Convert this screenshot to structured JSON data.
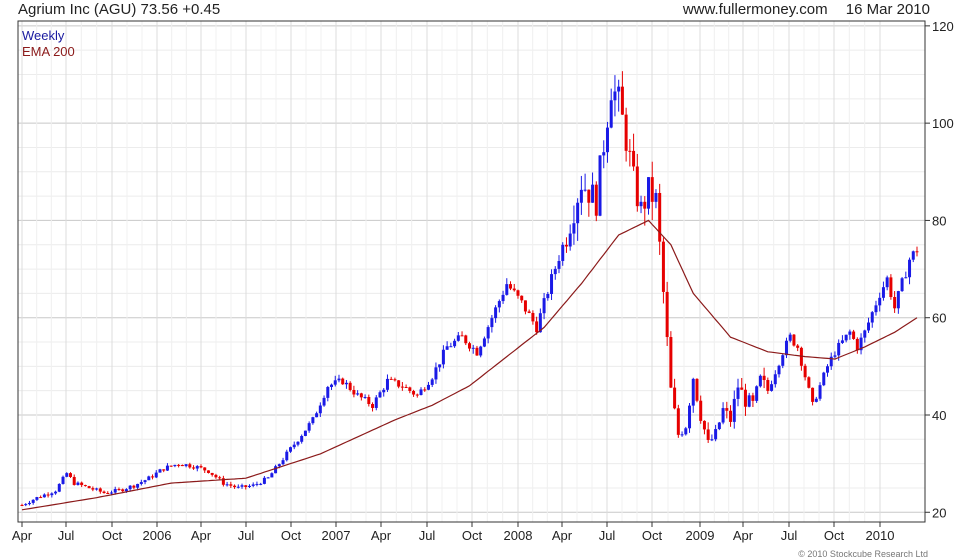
{
  "header": {
    "instrument": "Agrium Inc (AGU)",
    "last": "73.56",
    "change": "+0.45",
    "website": "www.fullermoney.com",
    "date": "16 Mar 2010"
  },
  "legend": {
    "weekly": "Weekly",
    "ema": "EMA 200"
  },
  "copyright": "© 2010 Stockcube Research Ltd",
  "colors": {
    "up": "#1a1ae6",
    "down": "#e60000",
    "ema": "#8b1a1a",
    "grid": "#d6d6d6"
  },
  "chart_data": {
    "type": "candlestick-ohlc",
    "title": "Agrium Inc (AGU)",
    "frequency": "Weekly",
    "ylim": [
      18,
      121
    ],
    "y_ticks": [
      20,
      40,
      60,
      80,
      100,
      120
    ],
    "x_ticks": [
      "Apr",
      "Jul",
      "Oct",
      "2006",
      "Apr",
      "Jul",
      "Oct",
      "2007",
      "Apr",
      "Jul",
      "Oct",
      "2008",
      "Apr",
      "Jul",
      "Oct",
      "2009",
      "Apr",
      "Jul",
      "Oct",
      "2010"
    ],
    "grid": true,
    "price_anchors": [
      [
        0,
        21.5
      ],
      [
        4,
        23
      ],
      [
        9,
        24.5
      ],
      [
        12,
        28
      ],
      [
        14,
        26
      ],
      [
        18,
        25
      ],
      [
        22,
        24
      ],
      [
        26,
        24.5
      ],
      [
        30,
        25.5
      ],
      [
        34,
        27
      ],
      [
        38,
        29
      ],
      [
        42,
        30
      ],
      [
        46,
        29.5
      ],
      [
        50,
        28.5
      ],
      [
        54,
        26
      ],
      [
        58,
        25
      ],
      [
        62,
        25.5
      ],
      [
        66,
        27
      ],
      [
        70,
        31
      ],
      [
        74,
        35
      ],
      [
        78,
        39
      ],
      [
        82,
        46
      ],
      [
        86,
        47
      ],
      [
        90,
        44
      ],
      [
        94,
        42
      ],
      [
        98,
        47
      ],
      [
        102,
        46
      ],
      [
        106,
        44
      ],
      [
        110,
        48
      ],
      [
        114,
        54
      ],
      [
        118,
        56
      ],
      [
        122,
        53
      ],
      [
        126,
        60
      ],
      [
        130,
        67
      ],
      [
        134,
        63
      ],
      [
        138,
        58
      ],
      [
        142,
        68
      ],
      [
        146,
        77
      ],
      [
        150,
        88
      ],
      [
        154,
        84
      ],
      [
        156,
        96
      ],
      [
        158,
        108
      ],
      [
        160,
        104
      ],
      [
        162,
        97
      ],
      [
        164,
        88
      ],
      [
        166,
        82
      ],
      [
        168,
        86
      ],
      [
        170,
        84
      ],
      [
        172,
        65
      ],
      [
        174,
        45
      ],
      [
        176,
        36
      ],
      [
        178,
        38
      ],
      [
        180,
        48
      ],
      [
        182,
        40
      ],
      [
        184,
        34
      ],
      [
        186,
        36
      ],
      [
        188,
        41
      ],
      [
        190,
        39
      ],
      [
        192,
        46
      ],
      [
        194,
        43
      ],
      [
        196,
        42
      ],
      [
        198,
        47
      ],
      [
        200,
        45
      ],
      [
        202,
        49
      ],
      [
        204,
        53
      ],
      [
        206,
        56
      ],
      [
        208,
        54
      ],
      [
        210,
        48
      ],
      [
        212,
        42
      ],
      [
        214,
        46
      ],
      [
        216,
        50
      ],
      [
        218,
        53
      ],
      [
        220,
        55
      ],
      [
        222,
        57
      ],
      [
        224,
        54
      ],
      [
        226,
        57
      ],
      [
        228,
        61
      ],
      [
        230,
        65
      ],
      [
        232,
        68
      ],
      [
        234,
        62
      ],
      [
        236,
        67
      ],
      [
        238,
        72
      ],
      [
        240,
        74
      ]
    ],
    "ema_200_anchors": [
      [
        0,
        20.5
      ],
      [
        20,
        23
      ],
      [
        40,
        26
      ],
      [
        60,
        27
      ],
      [
        80,
        32
      ],
      [
        100,
        39
      ],
      [
        110,
        42
      ],
      [
        120,
        46
      ],
      [
        130,
        52
      ],
      [
        140,
        58
      ],
      [
        150,
        67
      ],
      [
        160,
        77
      ],
      [
        168,
        80
      ],
      [
        174,
        75
      ],
      [
        180,
        65
      ],
      [
        190,
        56
      ],
      [
        200,
        53
      ],
      [
        210,
        52
      ],
      [
        218,
        51.5
      ],
      [
        226,
        54
      ],
      [
        234,
        57
      ],
      [
        240,
        60
      ]
    ]
  }
}
